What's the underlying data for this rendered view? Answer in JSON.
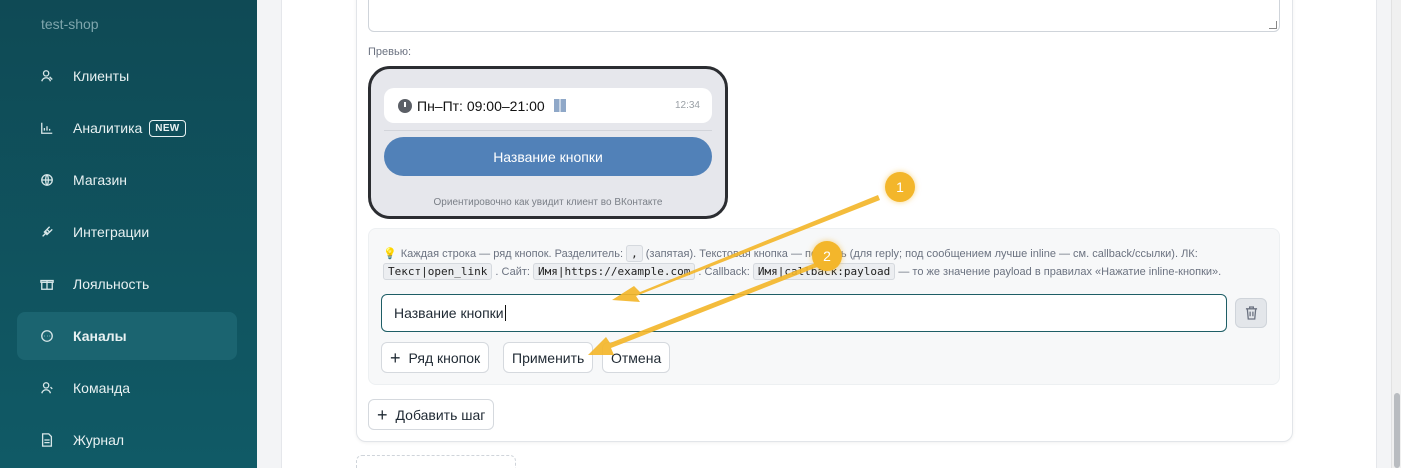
{
  "sidebar": {
    "shop_name": "test-shop",
    "items": [
      {
        "label": "Клиенты",
        "icon": "users-icon"
      },
      {
        "label": "Аналитика",
        "icon": "chart-icon",
        "badge": "NEW"
      },
      {
        "label": "Магазин",
        "icon": "globe-icon"
      },
      {
        "label": "Интеграции",
        "icon": "plug-icon"
      },
      {
        "label": "Лояльность",
        "icon": "gift-icon"
      },
      {
        "label": "Каналы",
        "icon": "chat-icon",
        "active": true
      },
      {
        "label": "Команда",
        "icon": "team-icon"
      },
      {
        "label": "Журнал",
        "icon": "document-icon"
      }
    ]
  },
  "preview": {
    "label": "Превью:",
    "message_text": "Пн–Пт: 09:00–21:00",
    "message_time": "12:34",
    "button_label": "Название кнопки",
    "caption": "Ориентировочно как увидит клиент во ВКонтакте"
  },
  "hint": {
    "part1": "Каждая строка — ряд кнопок. Разделитель:",
    "separator": ",",
    "part2": "(запятая). Текстовая кнопка — подпись (для reply; под сообщением лучше inline — см. callback/ссылки). ЛК:",
    "code_lk": "Текст|open_link",
    "part3": ". Сайт:",
    "code_site": "Имя|https://example.com",
    "part4": ". Callback:",
    "code_callback": "Имя|callback:payload",
    "part5": "— то же значение payload в правилах «Нажатие inline-кнопки»."
  },
  "editor": {
    "input_value": "Название кнопки",
    "add_row_label": "Ряд кнопок",
    "apply_label": "Применить",
    "cancel_label": "Отмена",
    "add_step_label": "Добавить шаг"
  },
  "annotations": {
    "marker1": "1",
    "marker2": "2",
    "color": "#f3b62b"
  },
  "colors": {
    "sidebar_bg": "#0f4a55",
    "sidebar_active": "#1b6470",
    "vk_button": "#5181b8",
    "input_border": "#1e5e66"
  }
}
